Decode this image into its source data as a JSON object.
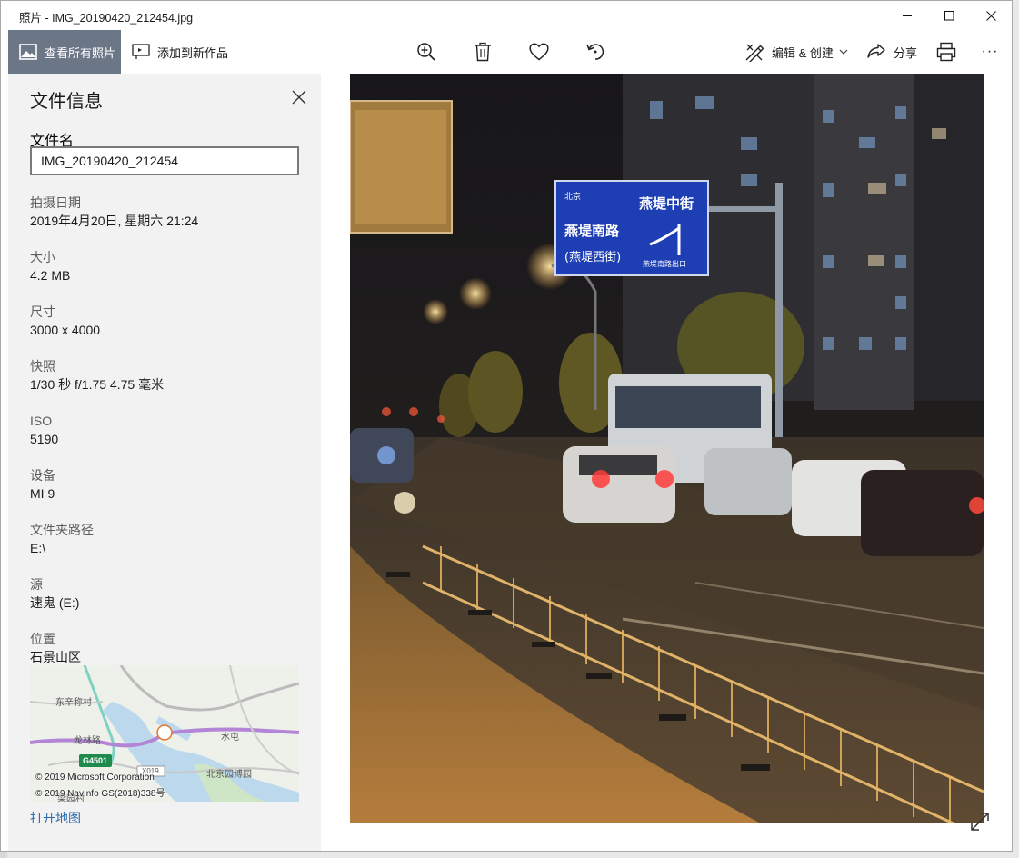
{
  "window": {
    "title": "照片 - IMG_20190420_212454.jpg"
  },
  "toolbar": {
    "view_all_label": "查看所有照片",
    "add_to_label": "添加到新作品",
    "edit_create_label": "编辑 & 创建",
    "share_label": "分享",
    "more_label": "···"
  },
  "info": {
    "title": "文件信息",
    "filename_label": "文件名",
    "filename_value": "IMG_20190420_212454",
    "date_label": "拍摄日期",
    "date_value": "2019年4月20日, 星期六 21:24",
    "size_label": "大小",
    "size_value": "4.2 MB",
    "dims_label": "尺寸",
    "dims_value": "3000 x 4000",
    "snapshot_label": "快照",
    "snapshot_value": "1/30 秒 f/1.75 4.75 毫米",
    "iso_label": "ISO",
    "iso_value": "5190",
    "device_label": "设备",
    "device_value": "MI 9",
    "folder_label": "文件夹路径",
    "folder_value": "E:\\",
    "source_label": "源",
    "source_value": "速鬼 (E:)",
    "location_label": "位置",
    "location_value": "石景山区",
    "open_map_label": "打开地图"
  },
  "map": {
    "labels": [
      "东辛称村",
      "龙林路",
      "水屯",
      "G4501",
      "X019",
      "北京园博园",
      "梁园村"
    ],
    "credit_1": "© 2019 Microsoft Corporation",
    "credit_2": "© 2019 NavInfo GS(2018)338号"
  },
  "photo_sign": {
    "north_label": "北京",
    "top_right": "燕堤中街",
    "left": "燕堤南路",
    "left_sub": "(燕堤西街)",
    "bottom_right": "燕堤南路出口"
  }
}
